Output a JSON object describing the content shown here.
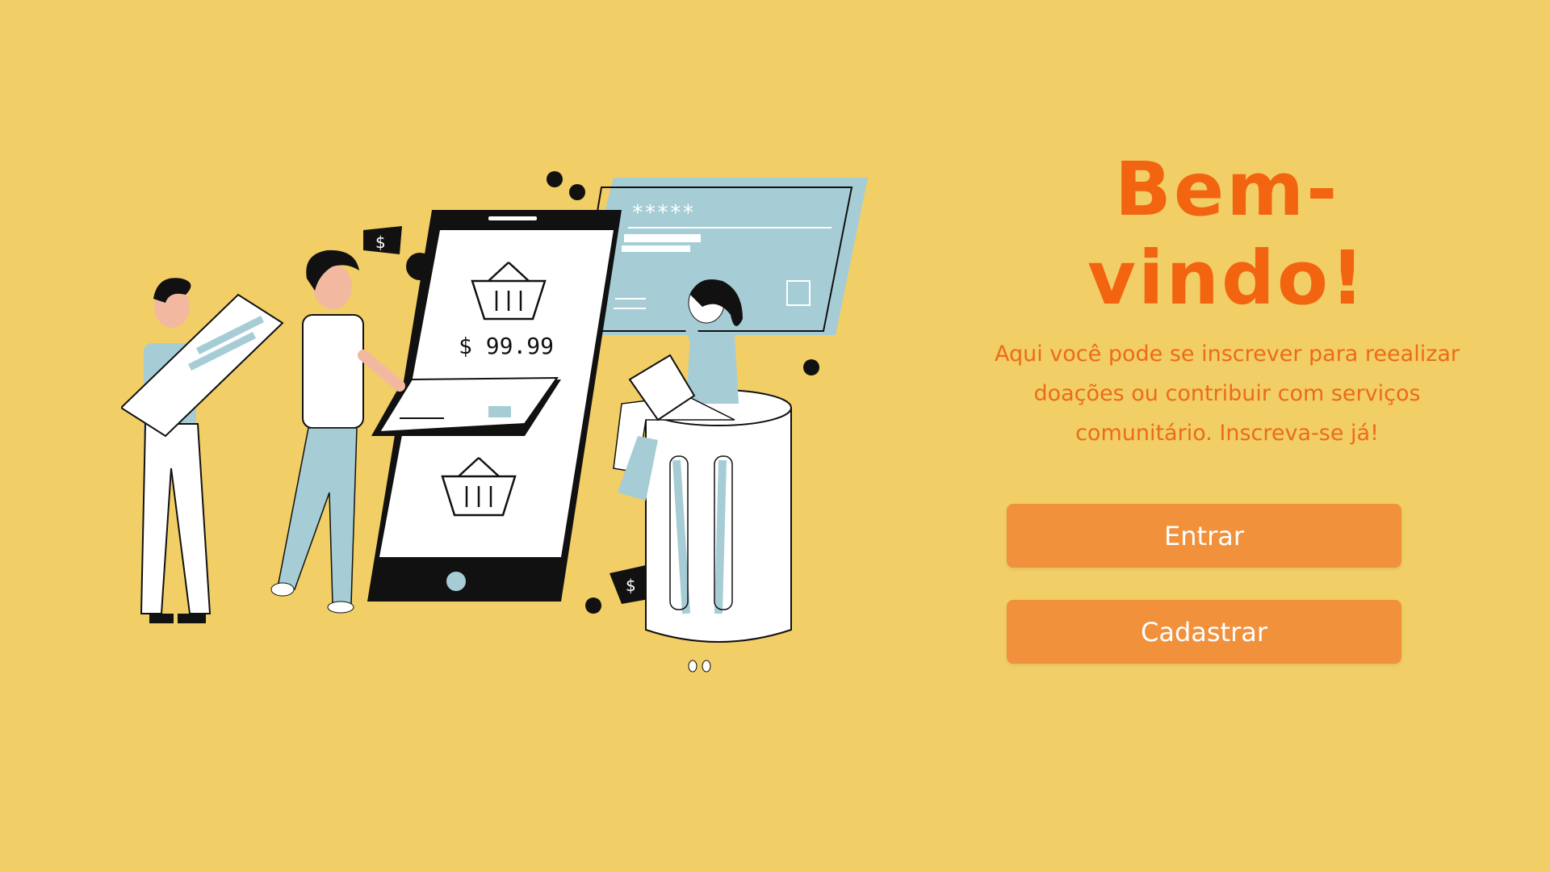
{
  "welcome": {
    "title": "Bem-vindo!",
    "subtitle": "Aqui você pode se inscrever para reealizar doações ou contribuir com serviços comunitário. Inscreva-se já!"
  },
  "actions": {
    "login_label": "Entrar",
    "signup_label": "Cadastrar"
  },
  "illustration": {
    "price_text": "$ 99.99",
    "password_mask": "*****",
    "money_symbol": "$"
  },
  "colors": {
    "background": "#f1ce66",
    "title": "#f26410",
    "button": "#f1913c",
    "accent": "#a6cdd6"
  }
}
